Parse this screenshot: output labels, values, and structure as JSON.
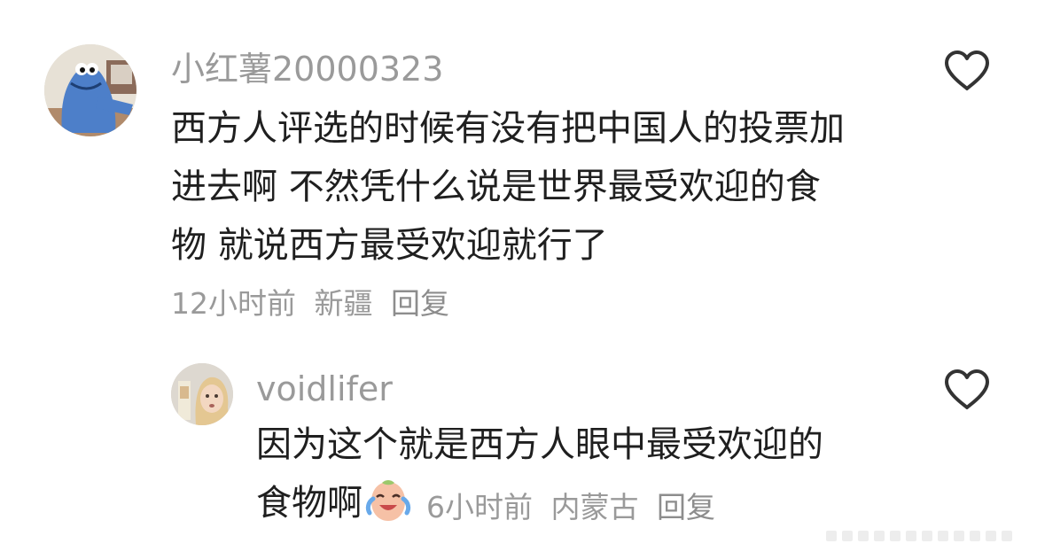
{
  "comments": [
    {
      "username": "小红薯20000323",
      "lines": [
        "西方人评选的时候有没有把中国人的投票加",
        "进去啊 不然凭什么说是世界最受欢迎的食",
        "物 就说西方最受欢迎就行了"
      ],
      "time": "12小时前",
      "location": "新疆",
      "reply_label": "回复",
      "avatar_icon": "blue-monster-costume-avatar",
      "like_icon": "heart-outline-icon"
    },
    {
      "username": "voidlifer",
      "lines": [
        "因为这个就是西方人眼中最受欢迎的",
        "食物啊"
      ],
      "emoji": "crying-laughing-peach-emoji",
      "time": "6小时前",
      "location": "内蒙古",
      "reply_label": "回复",
      "avatar_icon": "blonde-woman-avatar",
      "like_icon": "heart-outline-icon"
    }
  ],
  "colors": {
    "username": "#9a9a9a",
    "text": "#1f1f1f",
    "meta": "#9a9a9a",
    "icon": "#333333"
  }
}
